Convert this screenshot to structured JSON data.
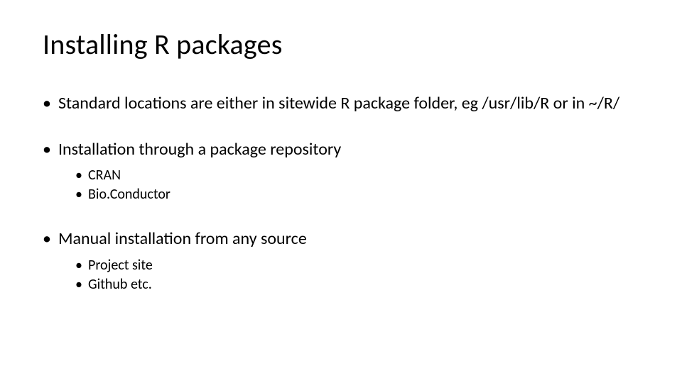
{
  "title": "Installing R packages",
  "bullets": {
    "b1": {
      "text": "Standard locations are either in sitewide R package folder, eg /usr/lib/R or in ~/R/"
    },
    "b2": {
      "text": "Installation through a package repository",
      "sub": {
        "s1": "CRAN",
        "s2": "Bio.Conductor"
      }
    },
    "b3": {
      "text": "Manual installation from any source",
      "sub": {
        "s1": "Project site",
        "s2": "Github etc."
      }
    }
  }
}
